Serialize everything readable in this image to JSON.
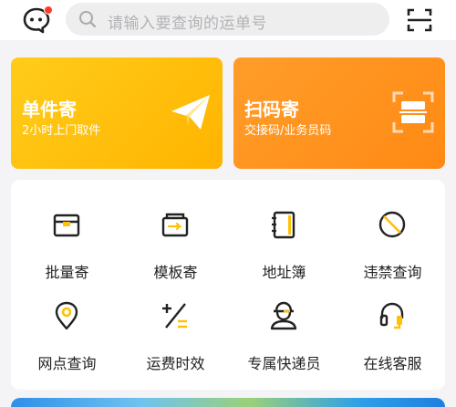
{
  "search": {
    "placeholder": "请输入要查询的运单号"
  },
  "cards": [
    {
      "title": "单件寄",
      "subtitle": "2小时上门取件",
      "icon": "paper-plane-icon",
      "color": "#ffc107"
    },
    {
      "title": "扫码寄",
      "subtitle": "交接码/业务员码",
      "icon": "scan-frame-icon",
      "color": "#ff9419"
    }
  ],
  "services": [
    {
      "label": "批量寄",
      "icon": "box-icon"
    },
    {
      "label": "模板寄",
      "icon": "template-icon"
    },
    {
      "label": "地址簿",
      "icon": "address-book-icon"
    },
    {
      "label": "违禁查询",
      "icon": "prohibited-icon"
    },
    {
      "label": "网点查询",
      "icon": "location-pin-icon"
    },
    {
      "label": "运费时效",
      "icon": "calculator-icon"
    },
    {
      "label": "专属快递员",
      "icon": "courier-icon"
    },
    {
      "label": "在线客服",
      "icon": "headset-icon"
    }
  ],
  "colors": {
    "accent": "#ffc107",
    "orange": "#ff9419",
    "notification": "#ff3b30"
  }
}
